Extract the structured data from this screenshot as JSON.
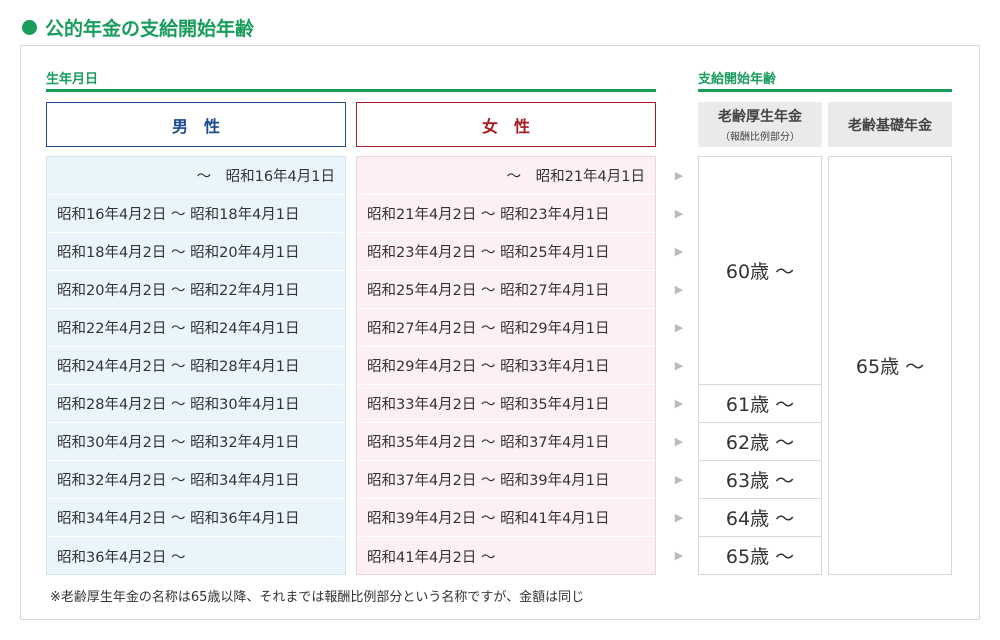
{
  "page_title": "公的年金の支給開始年齢",
  "birth_section_label": "生年月日",
  "start_section_label": "支給開始年齢",
  "headers": {
    "male": "男　性",
    "female": "女　性",
    "kosei_main": "老齢厚生年金",
    "kosei_sub": "（報酬比例部分）",
    "kiso": "老齢基礎年金"
  },
  "male_rows": [
    "～　昭和16年4月1日",
    "昭和16年4月2日 ～ 昭和18年4月1日",
    "昭和18年4月2日 ～ 昭和20年4月1日",
    "昭和20年4月2日 ～ 昭和22年4月1日",
    "昭和22年4月2日 ～ 昭和24年4月1日",
    "昭和24年4月2日 ～ 昭和28年4月1日",
    "昭和28年4月2日 ～ 昭和30年4月1日",
    "昭和30年4月2日 ～ 昭和32年4月1日",
    "昭和32年4月2日 ～ 昭和34年4月1日",
    "昭和34年4月2日 ～ 昭和36年4月1日",
    "昭和36年4月2日 ～"
  ],
  "female_rows": [
    "～　昭和21年4月1日",
    "昭和21年4月2日 ～ 昭和23年4月1日",
    "昭和23年4月2日 ～ 昭和25年4月1日",
    "昭和25年4月2日 ～ 昭和27年4月1日",
    "昭和27年4月2日 ～ 昭和29年4月1日",
    "昭和29年4月2日 ～ 昭和33年4月1日",
    "昭和33年4月2日 ～ 昭和35年4月1日",
    "昭和35年4月2日 ～ 昭和37年4月1日",
    "昭和37年4月2日 ～ 昭和39年4月1日",
    "昭和39年4月2日 ～ 昭和41年4月1日",
    "昭和41年4月2日 ～"
  ],
  "arrow_glyph": "▶",
  "kosei_ages": [
    "60歳 ～",
    "61歳 ～",
    "62歳 ～",
    "63歳 ～",
    "64歳 ～",
    "65歳 ～"
  ],
  "kiso_age": "65歳 ～",
  "note": "※老齢厚生年金の名称は65歳以降、それまでは報酬比例部分という名称ですが、金額は同じ",
  "colors": {
    "accent_green": "#1a9d5c",
    "male_blue": "#1b4a8f",
    "female_red": "#a51d24",
    "male_bg": "#eaf5fb",
    "female_bg": "#fdf0f3"
  }
}
